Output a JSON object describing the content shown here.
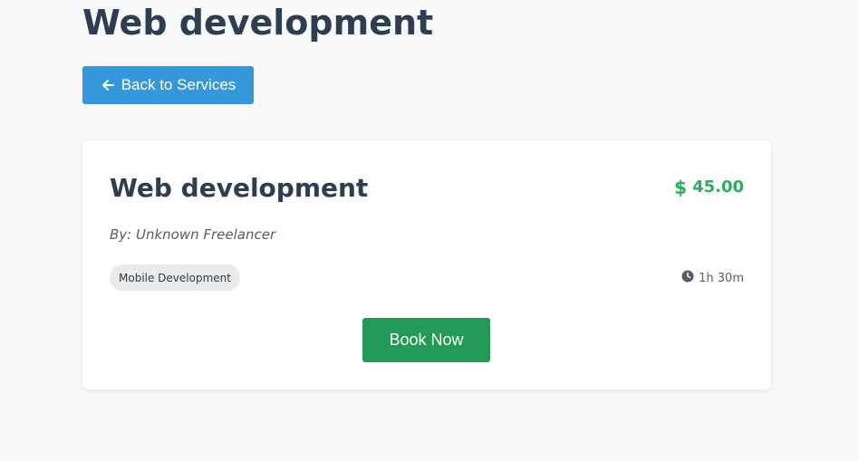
{
  "page": {
    "title": "Web development"
  },
  "nav": {
    "back_label": "Back to Services",
    "back_icon": "arrow-left-icon"
  },
  "service": {
    "title": "Web development",
    "price_symbol": "$",
    "price": "45.00",
    "freelancer": "By: Unknown Freelancer",
    "category": "Mobile Development",
    "duration": "1h 30m",
    "duration_icon": "clock-icon",
    "book_label": "Book Now"
  },
  "colors": {
    "background": "#f8f9fb",
    "heading": "#2c3e50",
    "primary_button": "#3498db",
    "price": "#27ae60",
    "book_button": "#229954",
    "badge_bg": "#e9ecef"
  }
}
